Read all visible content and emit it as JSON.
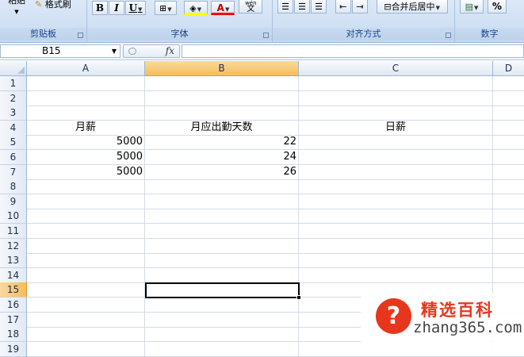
{
  "ribbon": {
    "clipboard": {
      "label": "剪贴板",
      "paste": "粘贴",
      "format_painter": "格式刷"
    },
    "font": {
      "label": "字体",
      "bold": "B",
      "italic": "I",
      "underline": "U",
      "font_color_glyph": "A",
      "wen_glyph": "wén",
      "wen_char": "文"
    },
    "alignment": {
      "label": "对齐方式",
      "merge_center": "合并后居中"
    },
    "number": {
      "label": "数字",
      "percent": "%"
    }
  },
  "formula_bar": {
    "name_box": "B15",
    "fx_label": "fx",
    "formula": ""
  },
  "columns": [
    "A",
    "B",
    "C",
    "D"
  ],
  "selected_column": "B",
  "rows": [
    "1",
    "2",
    "3",
    "4",
    "5",
    "6",
    "7",
    "8",
    "9",
    "10",
    "11",
    "12",
    "13",
    "14",
    "15",
    "16",
    "17",
    "18",
    "19"
  ],
  "selected_row": "15",
  "cells": {
    "A4": "月薪",
    "B4": "月应出勤天数",
    "C4": "日薪",
    "A5": "5000",
    "B5": "22",
    "A6": "5000",
    "B6": "24",
    "A7": "5000",
    "B7": "26"
  },
  "watermark": {
    "title": "精选百科",
    "url": "zhang365.com"
  },
  "colors": {
    "selection_header": "#f5bd5d",
    "ribbon_label": "#15428b",
    "watermark_red": "#e8361d"
  }
}
